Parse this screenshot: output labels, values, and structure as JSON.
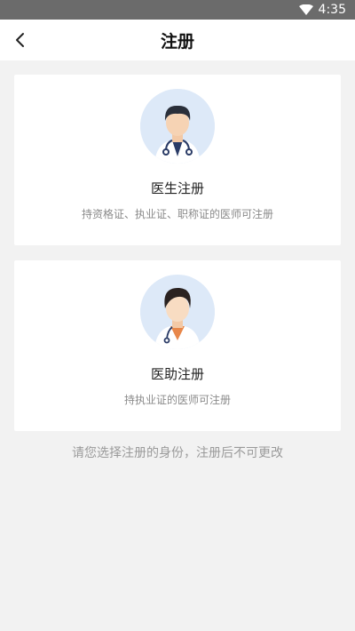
{
  "status_bar": {
    "time": "4:35"
  },
  "nav": {
    "title": "注册"
  },
  "cards": [
    {
      "title": "医生注册",
      "desc": "持资格证、执业证、职称证的医师可注册",
      "avatar_icon": "doctor-avatar-icon"
    },
    {
      "title": "医助注册",
      "desc": "持执业证的医师可注册",
      "avatar_icon": "assistant-avatar-icon"
    }
  ],
  "notice": "请您选择注册的身份，注册后不可更改",
  "colors": {
    "status_bar": "#6b6b6b",
    "background": "#f2f2f2",
    "avatar_bg": "#dde9f8"
  }
}
